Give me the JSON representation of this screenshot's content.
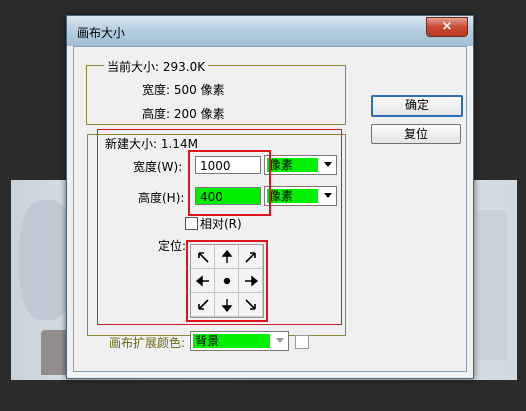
{
  "window": {
    "title": "画布大小",
    "close_glyph": "×"
  },
  "current_size": {
    "legend": "当前大小: 293.0K",
    "width_row": "宽度:  500 像素",
    "height_row": "高度:  200 像素"
  },
  "buttons": {
    "ok": "确定",
    "reset": "复位"
  },
  "new_size": {
    "legend": "新建大小: 1.14M",
    "width_label": "宽度(W):",
    "width_value": "1000",
    "width_unit": "像素",
    "height_label": "高度(H):",
    "height_value": "400",
    "height_unit": "像素",
    "relative_label": "相对(R)",
    "relative_checked": false,
    "anchor_label": "定位:",
    "anchor_selected": "center"
  },
  "extension": {
    "label": "画布扩展颜色:",
    "value": "背景"
  },
  "colors": {
    "highlight": "#e0141d",
    "green_field": "#00f000",
    "group_border": "#8c8a2a"
  },
  "icons": [
    "close-icon",
    "arrow-nw-icon",
    "arrow-n-icon",
    "arrow-ne-icon",
    "arrow-w-icon",
    "dot-icon",
    "arrow-e-icon",
    "arrow-sw-icon",
    "arrow-s-icon",
    "arrow-se-icon",
    "dropdown-arrow-icon"
  ]
}
